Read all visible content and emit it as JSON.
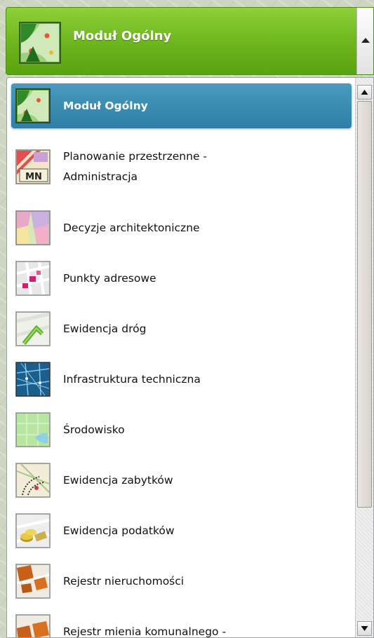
{
  "header": {
    "title": "Moduł Ogólny",
    "icon": "general-module-map-icon"
  },
  "dropdown": {
    "items": [
      {
        "label": "Moduł Ogólny",
        "icon": "general-module-map-icon",
        "selected": true
      },
      {
        "label": "Planowanie przestrzenne -\nAdministracja",
        "icon": "spatial-planning-mn-icon",
        "selected": false
      },
      {
        "label": "Decyzje architektoniczne",
        "icon": "architectural-decisions-icon",
        "selected": false
      },
      {
        "label": "Punkty adresowe",
        "icon": "address-points-icon",
        "selected": false
      },
      {
        "label": "Ewidencja dróg",
        "icon": "road-registry-icon",
        "selected": false
      },
      {
        "label": "Infrastruktura techniczna",
        "icon": "technical-infrastructure-icon",
        "selected": false
      },
      {
        "label": "Środowisko",
        "icon": "environment-icon",
        "selected": false
      },
      {
        "label": "Ewidencja zabytków",
        "icon": "monuments-registry-icon",
        "selected": false
      },
      {
        "label": "Ewidencja podatków",
        "icon": "tax-registry-coins-icon",
        "selected": false
      },
      {
        "label": "Rejestr nieruchomości",
        "icon": "real-estate-registry-icon",
        "selected": false
      },
      {
        "label": "Rejestr mienia komunalnego -",
        "icon": "municipal-property-icon",
        "selected": false
      }
    ]
  },
  "colors": {
    "header_green": "#6cb51c",
    "selected_blue": "#3a89b1"
  }
}
